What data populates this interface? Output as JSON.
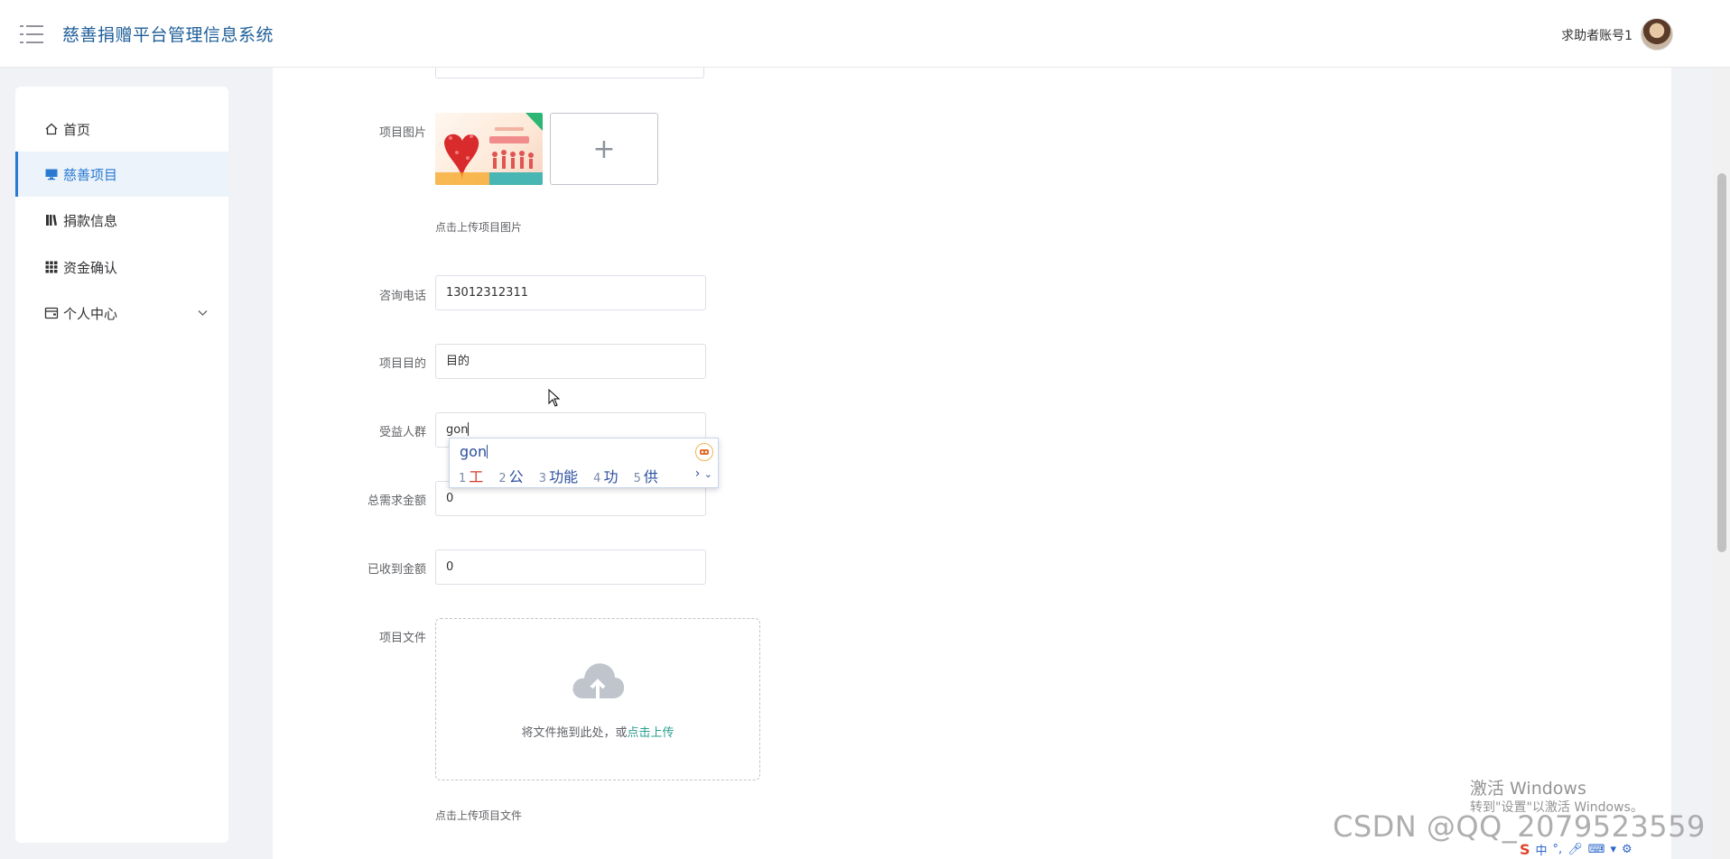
{
  "header": {
    "app_title": "慈善捐赠平台管理信息系统",
    "user_name": "求助者账号1"
  },
  "sidebar": {
    "items": [
      {
        "label": "首页",
        "icon": "home-icon"
      },
      {
        "label": "慈善项目",
        "icon": "monitor-icon",
        "active": true
      },
      {
        "label": "捐款信息",
        "icon": "notebook-icon"
      },
      {
        "label": "资金确认",
        "icon": "grid-icon"
      },
      {
        "label": "个人中心",
        "icon": "wallet-icon",
        "has_submenu": true
      }
    ]
  },
  "form": {
    "image_label": "项目图片",
    "image_hint": "点击上传项目图片",
    "phone_label": "咨询电话",
    "phone_value": "13012312311",
    "purpose_label": "项目目的",
    "purpose_value": "目的",
    "beneficiary_label": "受益人群",
    "beneficiary_value": "gon",
    "total_label": "总需求金额",
    "total_value": "0",
    "received_label": "已收到金额",
    "received_value": "0",
    "file_label": "项目文件",
    "dragger_text": "将文件拖到此处，或",
    "dragger_link": "点击上传",
    "file_hint": "点击上传项目文件"
  },
  "ime": {
    "composition": "gon",
    "candidates": [
      {
        "n": "1",
        "text": "工"
      },
      {
        "n": "2",
        "text": "公"
      },
      {
        "n": "3",
        "text": "功能"
      },
      {
        "n": "4",
        "text": "功"
      },
      {
        "n": "5",
        "text": "供"
      }
    ]
  },
  "overlay": {
    "activate_title": "激活 Windows",
    "activate_sub": "转到\"设置\"以激活 Windows。",
    "csdn": "CSDN @QQ_2079523559",
    "tray_ime": "中"
  },
  "colors": {
    "accent": "#2a7ad1",
    "title": "#1f5f99",
    "link": "#2a9d8f"
  }
}
